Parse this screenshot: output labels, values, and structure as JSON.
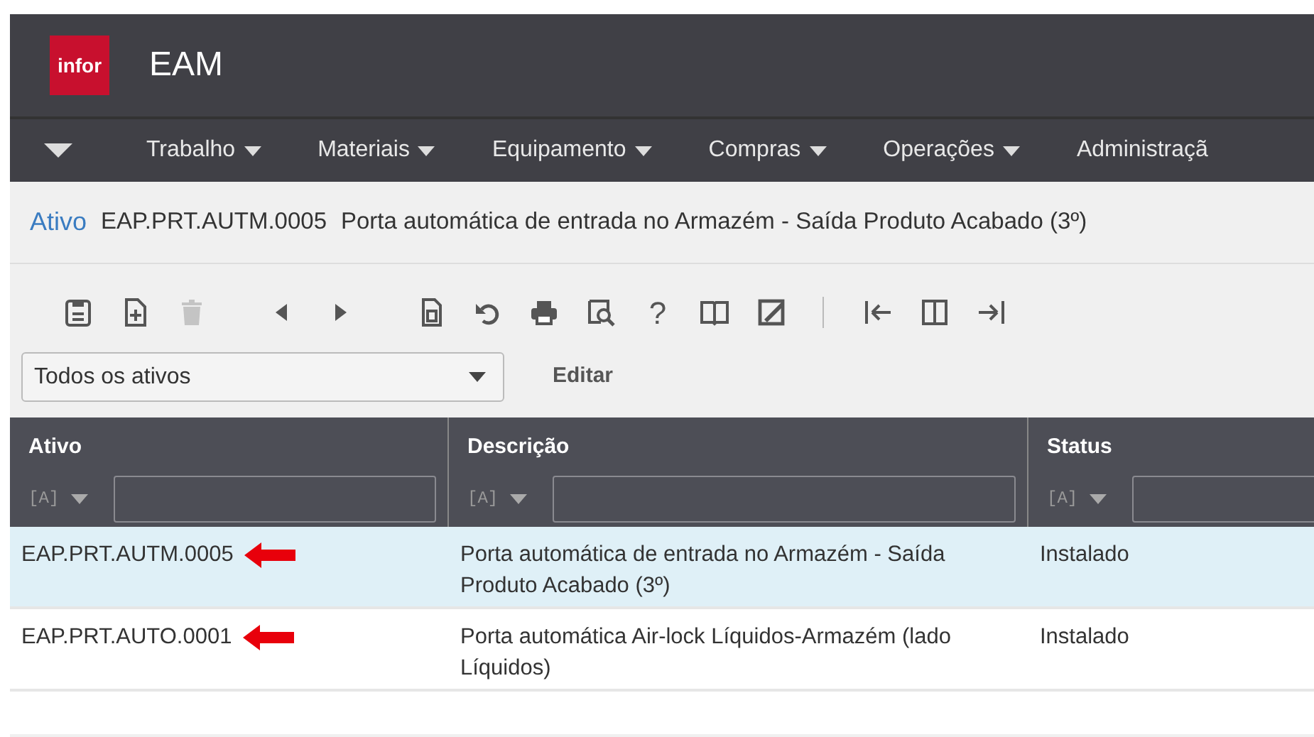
{
  "header": {
    "logo": "infor",
    "app_title": "EAM"
  },
  "menu": [
    {
      "label": "Trabalho"
    },
    {
      "label": "Materiais"
    },
    {
      "label": "Equipamento"
    },
    {
      "label": "Compras"
    },
    {
      "label": "Operações"
    },
    {
      "label": "Administraçã"
    }
  ],
  "record": {
    "entity": "Ativo",
    "code": "EAP.PRT.AUTM.0005",
    "description": "Porta automática de entrada no Armazém - Saída Produto Acabado (3º)"
  },
  "toolbar": [
    {
      "disabled": false
    },
    {
      "disabled": false
    },
    {
      "disabled": true
    },
    {
      "disabled": false
    },
    {
      "disabled": false
    },
    {
      "disabled": false
    },
    {
      "disabled": false
    },
    {
      "disabled": false
    },
    {
      "disabled": false
    },
    {
      "disabled": false,
      "label": "?"
    },
    {
      "disabled": false
    },
    {
      "disabled": false
    },
    {
      "disabled": false
    },
    {
      "disabled": false
    },
    {
      "disabled": false
    }
  ],
  "dataspy": {
    "value": "Todos os ativos",
    "edit_label": "Editar"
  },
  "table": {
    "columns": [
      {
        "label": "Ativo",
        "filter_operator": "[A]"
      },
      {
        "label": "Descrição",
        "filter_operator": "[A]"
      },
      {
        "label": "Status",
        "filter_operator": "[A]"
      }
    ],
    "rows": [
      {
        "cells": [
          "EAP.PRT.AUTM.0005",
          "Porta automática de entrada no Armazém - Saída Produto Acabado (3º)",
          "Instalado"
        ],
        "selected": true,
        "marked": true
      },
      {
        "cells": [
          "EAP.PRT.AUTO.0001",
          "Porta automática Air-lock Líquidos-Armazém (lado Líquidos)",
          "Instalado"
        ],
        "selected": false,
        "marked": true
      }
    ]
  }
}
